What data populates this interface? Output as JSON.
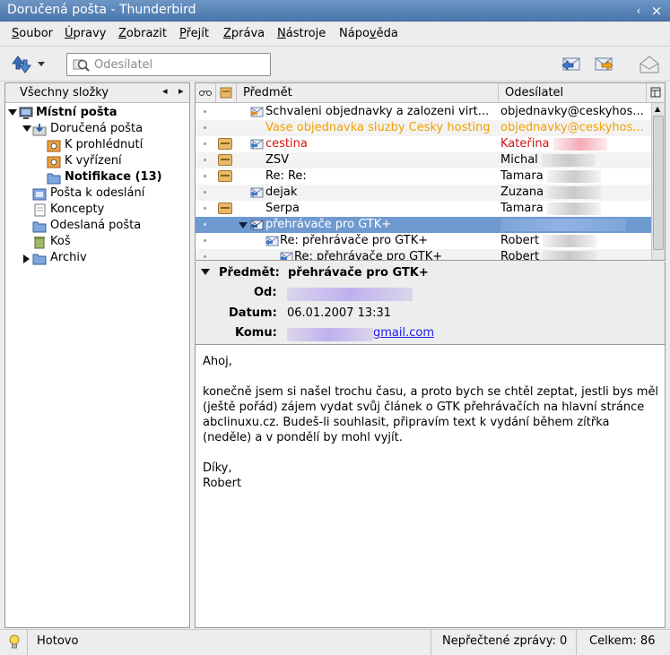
{
  "window": {
    "title": "Doručená pošta - Thunderbird",
    "controls": [
      "‹",
      "×"
    ]
  },
  "menubar": {
    "items": [
      {
        "label": "Soubor",
        "accel": "S"
      },
      {
        "label": "Úpravy",
        "accel": "Ú"
      },
      {
        "label": "Zobrazit",
        "accel": "Z"
      },
      {
        "label": "Přejít",
        "accel": "P"
      },
      {
        "label": "Zpráva",
        "accel": "Z"
      },
      {
        "label": "Nástroje",
        "accel": "N"
      },
      {
        "label": "Nápověda",
        "accel": "v"
      }
    ]
  },
  "toolbar": {
    "search_placeholder": "Odesílatel"
  },
  "folders": {
    "header": "Všechny složky",
    "items": [
      {
        "label": "Místní pošta",
        "bold": true,
        "icon": "computer-icon"
      },
      {
        "label": "Doručená pošta",
        "bold": false,
        "icon": "inbox-icon"
      },
      {
        "label": "K prohlédnutí",
        "bold": false,
        "icon": "saved-search-icon"
      },
      {
        "label": "K vyřízení",
        "bold": false,
        "icon": "saved-search-icon"
      },
      {
        "label": "Notifikace (13)",
        "bold": true,
        "icon": "folder-icon"
      },
      {
        "label": "Pošta k odeslání",
        "bold": false,
        "icon": "outbox-icon"
      },
      {
        "label": "Koncepty",
        "bold": false,
        "icon": "drafts-icon"
      },
      {
        "label": "Odeslaná pošta",
        "bold": false,
        "icon": "sent-icon"
      },
      {
        "label": "Koš",
        "bold": false,
        "icon": "trash-icon"
      },
      {
        "label": "Archiv",
        "bold": false,
        "icon": "folder-icon"
      }
    ]
  },
  "messages": {
    "columns": {
      "subject": "Předmět",
      "sender": "Odesílatel"
    },
    "rows": [
      {
        "subject": "Schvaleni objednavky a zalozeni virt...",
        "sender": "objednavky@ceskyhos...",
        "color": "normal",
        "label": false,
        "icon": "reply-icon",
        "blurred": false
      },
      {
        "subject": "Vase objednavka sluzby Cesky hosting",
        "sender": "objednavky@ceskyhos...",
        "color": "orange",
        "label": false,
        "icon": "",
        "blurred": false
      },
      {
        "subject": "cestina",
        "sender": "Kateřina",
        "color": "red",
        "label": true,
        "icon": "reply-icon",
        "blurred": true
      },
      {
        "subject": "ZSV",
        "sender": "Michal",
        "color": "normal",
        "label": true,
        "icon": "",
        "blurred": true
      },
      {
        "subject": "Re: Re:",
        "sender": "Tamara",
        "color": "normal",
        "label": true,
        "icon": "",
        "blurred": true
      },
      {
        "subject": "dejak",
        "sender": "Zuzana",
        "color": "normal",
        "label": false,
        "icon": "reply-icon",
        "blurred": true
      },
      {
        "subject": "Serpa",
        "sender": "Tamara",
        "color": "normal",
        "label": true,
        "icon": "",
        "blurred": true
      },
      {
        "subject": "přehrávače pro GTK+",
        "sender": "",
        "color": "normal",
        "label": false,
        "icon": "reply-icon",
        "blurred": true,
        "selected": true
      },
      {
        "subject": "Re: přehrávače pro GTK+",
        "sender": "Robert",
        "color": "normal",
        "label": false,
        "icon": "reply-icon",
        "blurred": true
      },
      {
        "subject": "Re: přehrávače pro GTK+",
        "sender": "Robert",
        "color": "normal",
        "label": false,
        "icon": "reply-icon",
        "blurred": true
      }
    ]
  },
  "header": {
    "subject_label": "Předmět:",
    "subject": "přehrávače pro GTK+",
    "from_label": "Od:",
    "date_label": "Datum:",
    "date": "06.01.2007 13:31",
    "to_label": "Komu:",
    "to_domain": "gmail.com"
  },
  "body": {
    "greeting": "Ahoj,",
    "paragraph": "konečně jsem si našel trochu času, a proto bych se chtěl zeptat, jestli bys měl (ještě pořád) zájem vydat svůj článek o GTK přehrávačích na hlavní stránce abclinuxu.cz. Budeš-li souhlasit, připravím text k vydání během zítřka (neděle) a v pondělí by mohl vyjít.",
    "closing": "Díky,",
    "signature": "Robert"
  },
  "status": {
    "text": "Hotovo",
    "unread": "Nepřečtené zprávy: 0",
    "total": "Celkem: 86"
  }
}
